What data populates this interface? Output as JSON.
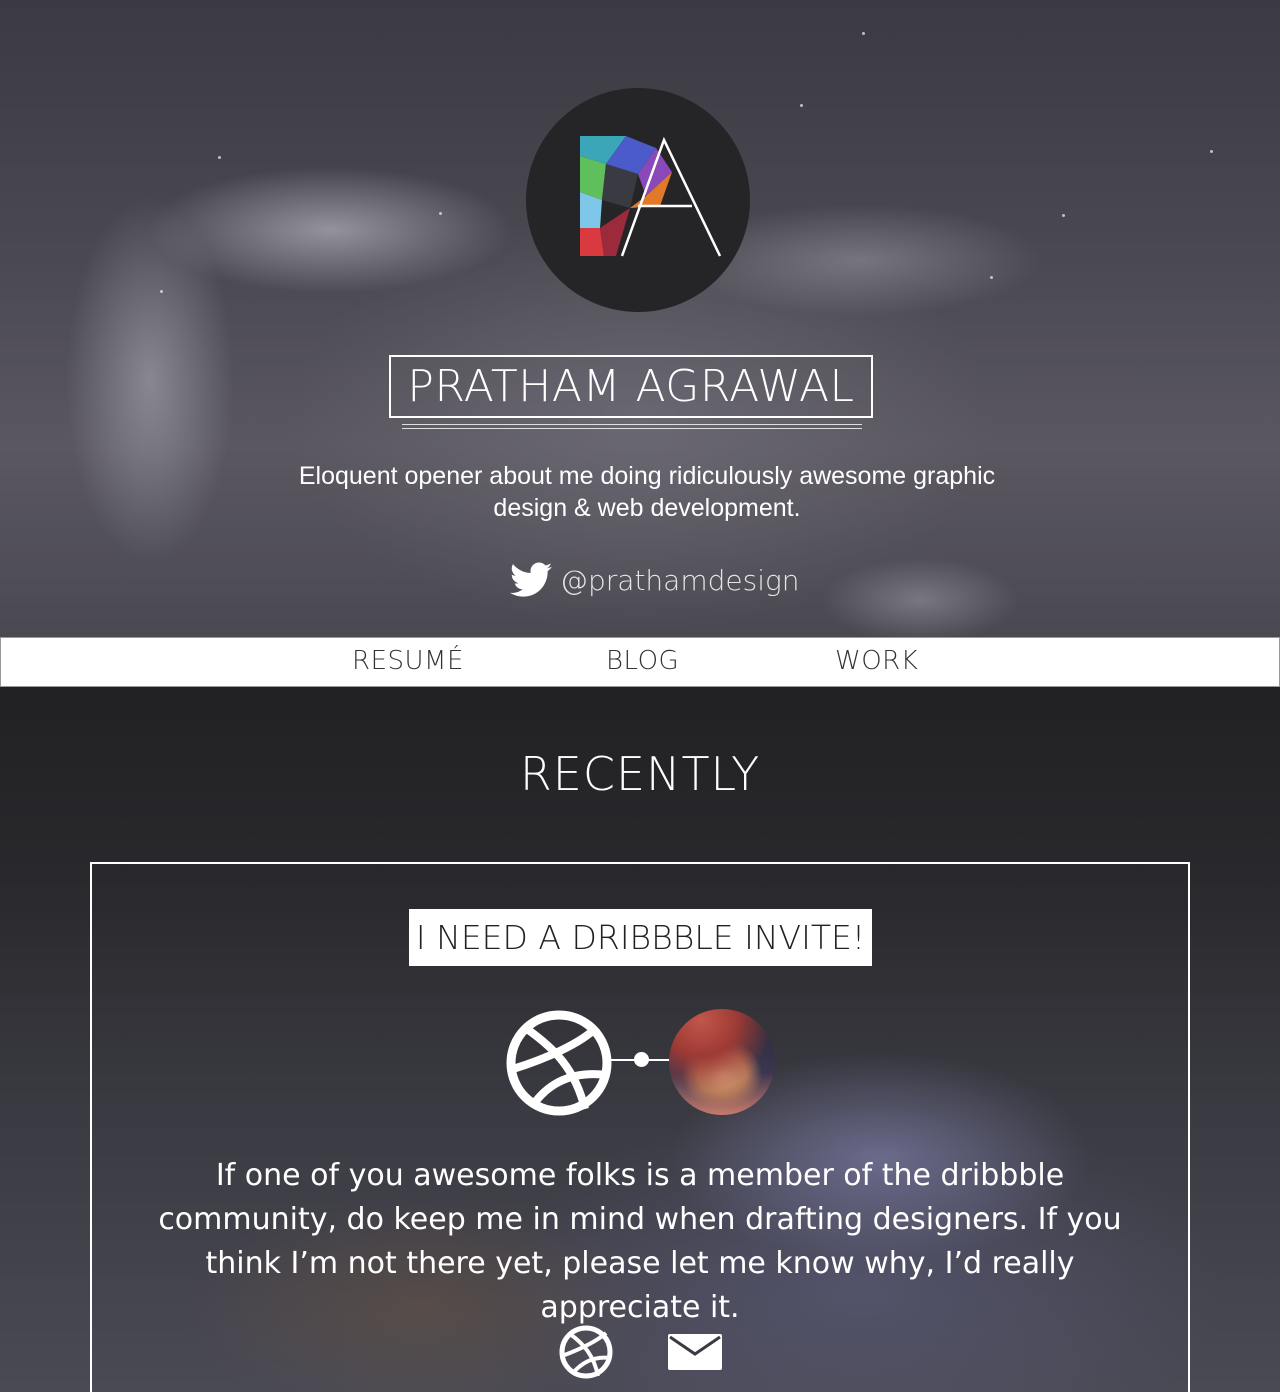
{
  "hero": {
    "logo_letters": "PA",
    "name": "PRATHAM AGRAWAL",
    "tagline": "Eloquent opener about me doing ridiculously awesome graphic design & web development.",
    "twitter_handle": "@prathamdesign",
    "twitter_icon": "twitter-bird-icon"
  },
  "nav": {
    "items": [
      {
        "label": "RESUMÉ"
      },
      {
        "label": "BLOG"
      },
      {
        "label": "WORK"
      }
    ]
  },
  "recent": {
    "heading": "RECENTLY",
    "card": {
      "title": "I NEED A DRIBBBLE INVITE!",
      "body": "If one of you awesome folks is a member of the dribbble community, do keep me in mind when drafting designers. If you think I’m not there yet, please let me know why, I’d really appreciate it.",
      "icons": [
        "dribbble-icon",
        "mail-icon"
      ]
    }
  },
  "colors": {
    "nav_bg": "#ffffff",
    "nav_text": "#333333",
    "logo_bg": "#252527",
    "text": "#ffffff"
  }
}
